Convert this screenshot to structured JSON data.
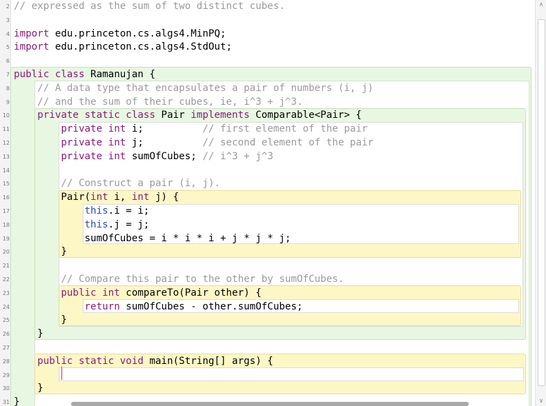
{
  "editor": {
    "lines": [
      {
        "n": "2",
        "segs": [
          {
            "t": "// expressed as the sum of two distinct cubes.",
            "c": "cm"
          }
        ]
      },
      {
        "n": "3",
        "segs": []
      },
      {
        "n": "4",
        "segs": [
          {
            "t": "import",
            "c": "kw"
          },
          {
            "t": " edu.princeton.cs.algs4.MinPQ;"
          }
        ]
      },
      {
        "n": "5",
        "segs": [
          {
            "t": "import",
            "c": "kw"
          },
          {
            "t": " edu.princeton.cs.algs4.StdOut;"
          }
        ]
      },
      {
        "n": "6",
        "segs": []
      },
      {
        "n": "7",
        "segs": [
          {
            "t": "public class",
            "c": "kw"
          },
          {
            "t": " Ramanujan {"
          }
        ]
      },
      {
        "n": "8",
        "segs": [
          {
            "t": "    "
          },
          {
            "t": "// A data type that encapsulates a pair of numbers (i, j)",
            "c": "cm"
          }
        ]
      },
      {
        "n": "9",
        "segs": [
          {
            "t": "    "
          },
          {
            "t": "// and the sum of their cubes, ie, i^3 + j^3.",
            "c": "cm"
          }
        ]
      },
      {
        "n": "10",
        "segs": [
          {
            "t": "    "
          },
          {
            "t": "private static class",
            "c": "kw"
          },
          {
            "t": " Pair "
          },
          {
            "t": "implements",
            "c": "kw"
          },
          {
            "t": " Comparable<Pair> {"
          }
        ]
      },
      {
        "n": "11",
        "segs": [
          {
            "t": "        "
          },
          {
            "t": "private int",
            "c": "kw"
          },
          {
            "t": " i;          "
          },
          {
            "t": "// first element of the pair",
            "c": "cm"
          }
        ]
      },
      {
        "n": "12",
        "segs": [
          {
            "t": "        "
          },
          {
            "t": "private int",
            "c": "kw"
          },
          {
            "t": " j;          "
          },
          {
            "t": "// second element of the pair",
            "c": "cm"
          }
        ]
      },
      {
        "n": "13",
        "segs": [
          {
            "t": "        "
          },
          {
            "t": "private int",
            "c": "kw"
          },
          {
            "t": " sumOfCubes; "
          },
          {
            "t": "// i^3 + j^3",
            "c": "cm"
          }
        ]
      },
      {
        "n": "14",
        "segs": []
      },
      {
        "n": "15",
        "segs": [
          {
            "t": "        "
          },
          {
            "t": "// Construct a pair (i, j).",
            "c": "cm"
          }
        ]
      },
      {
        "n": "16",
        "segs": [
          {
            "t": "        Pair("
          },
          {
            "t": "int",
            "c": "kw"
          },
          {
            "t": " i, "
          },
          {
            "t": "int",
            "c": "kw"
          },
          {
            "t": " j) {"
          }
        ]
      },
      {
        "n": "17",
        "segs": [
          {
            "t": "            "
          },
          {
            "t": "this",
            "c": "th"
          },
          {
            "t": ".i = i;"
          }
        ]
      },
      {
        "n": "18",
        "segs": [
          {
            "t": "            "
          },
          {
            "t": "this",
            "c": "th"
          },
          {
            "t": ".j = j;"
          }
        ]
      },
      {
        "n": "19",
        "segs": [
          {
            "t": "            sumOfCubes = i * i * i + j * j * j;"
          }
        ]
      },
      {
        "n": "20",
        "segs": [
          {
            "t": "        }"
          }
        ]
      },
      {
        "n": "21",
        "segs": []
      },
      {
        "n": "22",
        "segs": [
          {
            "t": "        "
          },
          {
            "t": "// Compare this pair to the other by sumOfCubes.",
            "c": "cm"
          }
        ]
      },
      {
        "n": "23",
        "segs": [
          {
            "t": "        "
          },
          {
            "t": "public int",
            "c": "kw"
          },
          {
            "t": " compareTo(Pair other) {"
          }
        ]
      },
      {
        "n": "24",
        "segs": [
          {
            "t": "            "
          },
          {
            "t": "return",
            "c": "kw"
          },
          {
            "t": " sumOfCubes - other.sumOfCubes;"
          }
        ]
      },
      {
        "n": "25",
        "segs": [
          {
            "t": "        }"
          }
        ]
      },
      {
        "n": "26",
        "segs": [
          {
            "t": "    }"
          }
        ]
      },
      {
        "n": "27",
        "segs": []
      },
      {
        "n": "28",
        "segs": [
          {
            "t": "    "
          },
          {
            "t": "public static void",
            "c": "kw"
          },
          {
            "t": " main(String[] args) {"
          }
        ]
      },
      {
        "n": "29",
        "segs": []
      },
      {
        "n": "30",
        "segs": [
          {
            "t": "    }"
          }
        ]
      },
      {
        "n": "31",
        "segs": [
          {
            "t": "}"
          }
        ]
      }
    ]
  },
  "scrollbar": {
    "up_icon": "chevron-up-icon",
    "down_icon": "chevron-down-icon",
    "up_glyph": "∧",
    "down_glyph": "∨"
  }
}
